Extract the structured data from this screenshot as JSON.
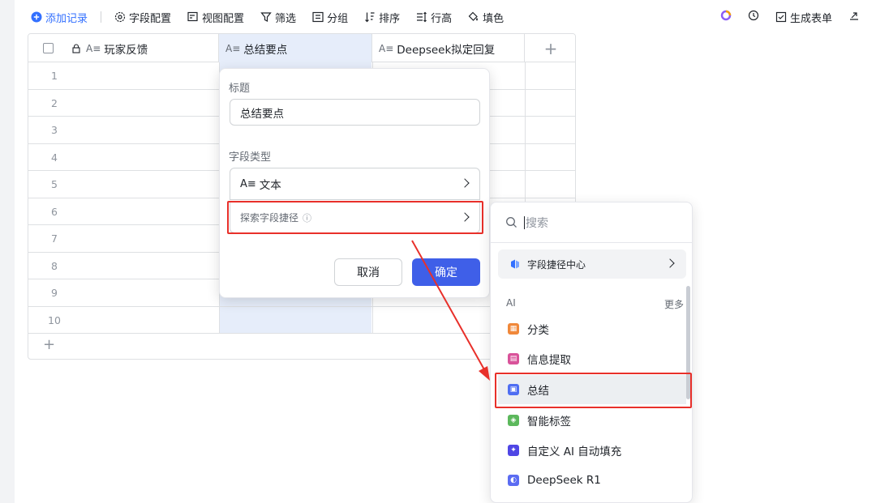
{
  "toolbar": {
    "add_record": "添加记录",
    "field_config": "字段配置",
    "view_config": "视图配置",
    "filter": "筛选",
    "group": "分组",
    "sort": "排序",
    "row_height": "行高",
    "fill_color": "填色",
    "generate_form": "生成表单"
  },
  "table": {
    "columns": [
      "玩家反馈",
      "总结要点",
      "Deepseek拟定回复"
    ],
    "field_type_glyph": "A≡",
    "add_column": "+",
    "rows": [
      "1",
      "2",
      "3",
      "4",
      "5",
      "6",
      "7",
      "8",
      "9",
      "10"
    ],
    "add_row": "+"
  },
  "field_popup": {
    "title_label": "标题",
    "title_value": "总结要点",
    "type_label": "字段类型",
    "type_value": "文本",
    "explore_label": "探索字段捷径",
    "info_glyph": "ⓘ",
    "cancel": "取消",
    "confirm": "确定"
  },
  "shortcut_menu": {
    "search_placeholder": "搜索",
    "center": "字段捷径中心",
    "section": "AI",
    "more": "更多",
    "items": [
      {
        "label": "分类",
        "color": "#f0883a",
        "icon": "grid-icon"
      },
      {
        "label": "信息提取",
        "color": "#d9539a",
        "icon": "extract-icon"
      },
      {
        "label": "总结",
        "color": "#4f6ef2",
        "icon": "doc-icon"
      },
      {
        "label": "智能标签",
        "color": "#5cb85c",
        "icon": "tag-icon"
      },
      {
        "label": "自定义 AI 自动填充",
        "color": "#4f46e5",
        "icon": "sparkle-icon"
      },
      {
        "label": "DeepSeek R1",
        "color": "#5b6cf2",
        "icon": "deepseek-icon"
      }
    ]
  },
  "colors": {
    "accent": "#3370ff",
    "confirm_button": "#3f5fe8",
    "highlight_column": "#e6edfa",
    "annotation_red": "#e8302a"
  }
}
